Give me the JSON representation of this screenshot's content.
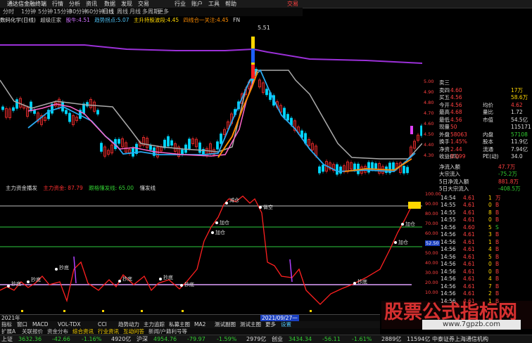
{
  "topbar": {
    "app_title": "通达信金融终端",
    "menus": [
      "行情",
      "分析",
      "资讯",
      "数据",
      "发现",
      "交易",
      "行业",
      "账户",
      "工具",
      "帮助"
    ],
    "right_label": "交易"
  },
  "toolbar": {
    "items": [
      "分时",
      "1分钟",
      "5分钟",
      "15分钟",
      "30分钟",
      "60分钟",
      "日线",
      "周线",
      "月线",
      "多周期",
      "更多"
    ]
  },
  "legend1": {
    "stock": "数码化学(日线)",
    "ind": "超级庄家",
    "items": [
      {
        "t": "股牛:4.51",
        "c": "#d070ff"
      },
      {
        "t": "趋势拐点:5.07",
        "c": "#4fc3f7"
      },
      {
        "t": "主升持股波段:4.45",
        "c": "#ffd700"
      },
      {
        "t": "四线合一关注:4.45",
        "c": "#ff8c00"
      },
      {
        "t": "FN",
        "c": "#ddd"
      }
    ],
    "peak_label": "5.51"
  },
  "legend2": {
    "name": "主力资金播发",
    "items": [
      {
        "t": "主力资金: 87.79",
        "c": "#ff3030"
      },
      {
        "t": "跟格懂发线: 65.00",
        "c": "#32cd32"
      },
      {
        "t": "懂发线",
        "c": "#ddd"
      }
    ]
  },
  "quote": {
    "rows": [
      {
        "l": "卖三",
        "v": "",
        "x": "",
        "xc": "#ddd"
      },
      {
        "l": "卖四",
        "v": "4.60",
        "x": "17万",
        "xc": "#ffd700"
      },
      {
        "l": "买五",
        "v": "4.56",
        "x": "58.6万",
        "xc": "#ffd700"
      },
      {
        "l": "今开",
        "v": "4.56",
        "x2l": "均价",
        "x": "4.62",
        "xc": "#ff4040"
      },
      {
        "l": "最高",
        "v": "4.68",
        "x2l": "量比",
        "x": "1.72",
        "xc": "#ddd"
      },
      {
        "l": "最低",
        "v": "4.56",
        "x2l": "市值",
        "x": "54.5亿",
        "xc": "#ddd"
      },
      {
        "l": "现量",
        "v": "50",
        "x2l": "",
        "x": "115171",
        "xc": "#ddd"
      },
      {
        "l": "外盘",
        "v": "58063",
        "x2l": "内盘",
        "x": "57108",
        "xc": "#32cd32"
      },
      {
        "l": "换手",
        "v": "1.45%",
        "x2l": "股本",
        "x": "11.9亿",
        "xc": "#ddd"
      },
      {
        "l": "净资",
        "v": "2.44",
        "x2l": "流通",
        "x": "7.94亿",
        "xc": "#ddd"
      },
      {
        "l": "收益(四)",
        "v": "0.099",
        "x2l": "PE(动)",
        "x": "34.0",
        "xc": "#ddd"
      }
    ],
    "flows": [
      {
        "l": "净流入额",
        "v": "47.7万",
        "c": "#ff4040"
      },
      {
        "l": "大宗流入",
        "v": "-75.2万",
        "c": "#32cd32"
      },
      {
        "l": "5日净流入额",
        "v": "881.8万",
        "c": "#ff4040"
      },
      {
        "l": "5日大宗流入",
        "v": "-408.5万",
        "c": "#32cd32"
      }
    ],
    "ticks": [
      {
        "t": "14:54",
        "p": "4.61",
        "v": "1",
        "f": "万"
      },
      {
        "t": "14:55",
        "p": "4.61",
        "v": "0",
        "f": "B"
      },
      {
        "t": "14:55",
        "p": "4.61",
        "v": "8",
        "f": "B"
      },
      {
        "t": "14:55",
        "p": "4.61",
        "v": "0",
        "f": "B"
      },
      {
        "t": "14:56",
        "p": "4.60",
        "v": "5",
        "f": "S"
      },
      {
        "t": "14:56",
        "p": "4.61",
        "v": "3",
        "f": "B"
      },
      {
        "t": "14:56",
        "p": "4.61",
        "v": "1",
        "f": "B"
      },
      {
        "t": "14:56",
        "p": "4.61",
        "v": "4",
        "f": "B"
      },
      {
        "t": "14:56",
        "p": "4.61",
        "v": "5",
        "f": "B"
      },
      {
        "t": "14:56",
        "p": "4.61",
        "v": "0",
        "f": "B"
      },
      {
        "t": "14:56",
        "p": "4.61",
        "v": "0",
        "f": "B"
      },
      {
        "t": "14:56",
        "p": "4.61",
        "v": "4",
        "f": "B"
      },
      {
        "t": "14:56",
        "p": "4.61",
        "v": "7",
        "f": "B"
      },
      {
        "t": "14:56",
        "p": "4.61",
        "v": "2",
        "f": "B"
      },
      {
        "t": "14:56",
        "p": "4.61",
        "v": "1",
        "f": "B"
      }
    ],
    "price_axis": [
      "5.00",
      "4.90",
      "4.80",
      "4.70",
      "4.60",
      "4.50",
      "4.40",
      "4.30"
    ],
    "ind_axis": [
      "100.00",
      "90.00",
      "80.00",
      "70.00",
      "60.00",
      "52.50",
      "50.00",
      "40.00",
      "30.00",
      "20.00",
      "10.00"
    ]
  },
  "bottom": {
    "date_left": "2021年",
    "date_mid": "2021/09/27一",
    "tabs": [
      "指标",
      "窗口",
      "MACD",
      "VOL-TDX",
      "CCI",
      "趋势动力",
      "主力追踪",
      "私募主图",
      "MA2",
      "测试副图",
      "测试主图",
      "更多",
      "设置"
    ],
    "tabs2": [
      "扩展A",
      "关联报价",
      "资金分布",
      "综合资讯",
      "行业资讯",
      "互动问答",
      "新闻/户籍利号等"
    ]
  },
  "status": [
    {
      "t": "上证",
      "c": "#ddd"
    },
    {
      "t": "3632.36",
      "c": "#32cd32"
    },
    {
      "t": "-42.66",
      "c": "#32cd32"
    },
    {
      "t": "-1.16%",
      "c": "#32cd32"
    },
    {
      "t": "4920亿",
      "c": "#ddd"
    },
    {
      "t": "沪深",
      "c": "#ddd"
    },
    {
      "t": "4954.76",
      "c": "#32cd32"
    },
    {
      "t": "-79.97",
      "c": "#32cd32"
    },
    {
      "t": "-1.59%",
      "c": "#32cd32"
    },
    {
      "t": "2979亿",
      "c": "#ddd"
    },
    {
      "t": "创业",
      "c": "#ddd"
    },
    {
      "t": "3434.34",
      "c": "#32cd32"
    },
    {
      "t": "-56.11",
      "c": "#32cd32"
    },
    {
      "t": "-1.61%",
      "c": "#32cd32"
    },
    {
      "t": "2889亿",
      "c": "#ddd"
    },
    {
      "t": "11594亿 中泰证券上海通信机构",
      "c": "#ddd"
    }
  ],
  "watermark": {
    "text": "股票公式指标网",
    "url": "www.7gpzb.com"
  },
  "signals": {
    "chaodi": "抄底",
    "jiacang": "加仓",
    "jianchang": "减仓",
    "xiankong": "做空"
  }
}
